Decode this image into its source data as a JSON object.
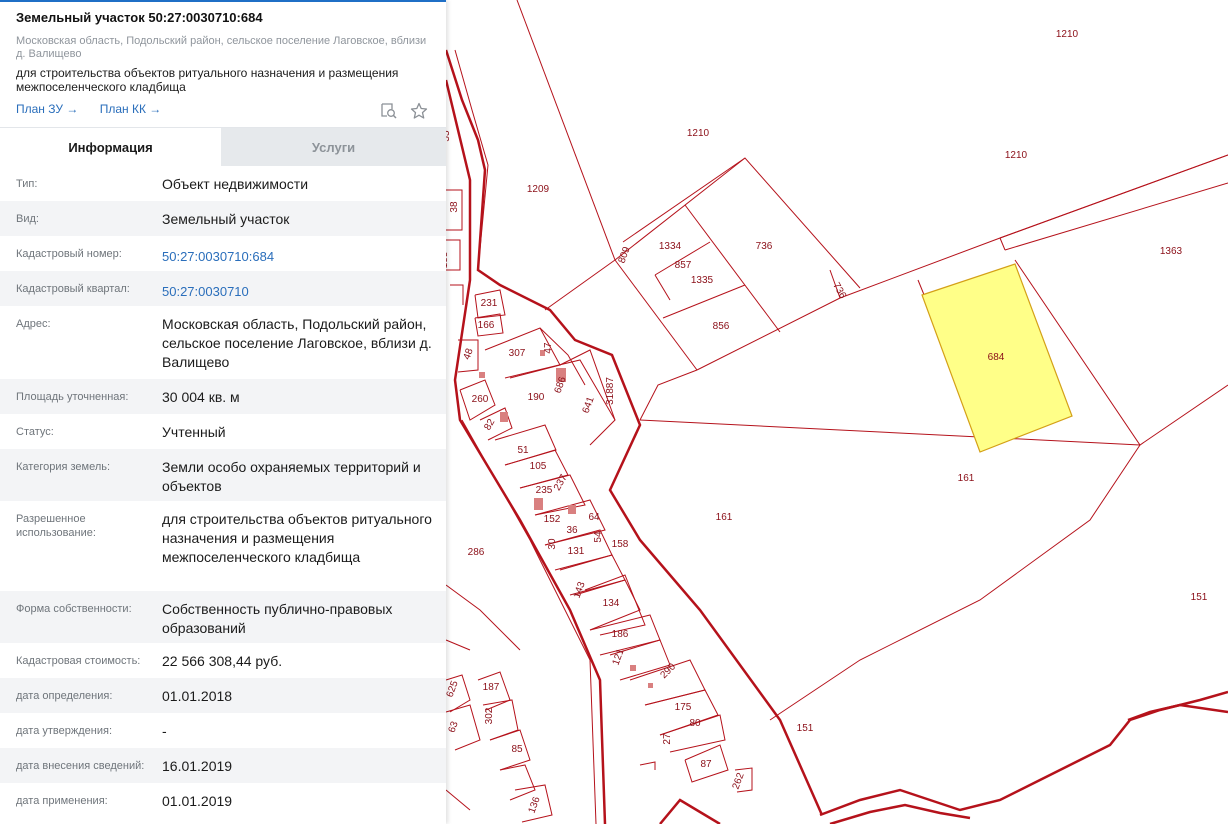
{
  "panel": {
    "title": "Земельный участок 50:27:0030710:684",
    "address": "Московская область, Подольский район, сельское поселение Лаговское, вблизи д. Валищево",
    "purpose": "для строительства объектов ритуального назначения и размещения межпоселенческого кладбища",
    "links": {
      "plan_zu": "План ЗУ →",
      "plan_kk": "План КК →"
    },
    "icons": [
      "search-map-icon",
      "star-icon"
    ],
    "tabs": [
      {
        "label": "Информация",
        "active": true
      },
      {
        "label": "Услуги",
        "active": false
      }
    ],
    "fields": [
      {
        "label": "Тип:",
        "value": "Объект недвижимости"
      },
      {
        "label": "Вид:",
        "value": "Земельный участок"
      },
      {
        "label": "Кадастровый номер:",
        "value": "50:27:0030710:684",
        "link": true
      },
      {
        "label": "Кадастровый квартал:",
        "value": "50:27:0030710",
        "link": true
      },
      {
        "label": "Адрес:",
        "value": "Московская область, Подольский район, сельское поселение Лаговское, вблизи д. Валищево"
      },
      {
        "label": "Площадь уточненная:",
        "value": "30 004 кв. м"
      },
      {
        "label": "Статус:",
        "value": "Учтенный"
      },
      {
        "label": "Категория земель:",
        "value": "Земли особо охраняемых территорий и объектов"
      },
      {
        "label": "Разрешенное использование:",
        "value": "для строительства объектов ритуального назначения и размещения межпоселенческого кладбища"
      },
      {
        "label": "Форма собственности:",
        "value": "Собственность публично-правовых образований"
      },
      {
        "label": "Кадастровая стоимость:",
        "value": "22 566 308,44 руб."
      },
      {
        "label": "дата определения:",
        "value": "01.01.2018"
      },
      {
        "label": "дата утверждения:",
        "value": "-"
      },
      {
        "label": "дата внесения сведений:",
        "value": "16.01.2019"
      },
      {
        "label": "дата применения:",
        "value": "01.01.2019"
      }
    ]
  },
  "map": {
    "colors": {
      "border": "#b5121b",
      "highlight_fill": "#ffff88",
      "highlight_stroke": "#d4a017",
      "label": "#8b0f18"
    },
    "highlighted_parcel": "684",
    "labels": [
      "1210",
      "1210",
      "1210",
      "1209",
      "1363",
      "809",
      "1334",
      "857",
      "1335",
      "736",
      "736",
      "856",
      "684",
      "161",
      "161",
      "151",
      "151",
      "286",
      "231",
      "166",
      "307",
      "47",
      "48",
      "190",
      "641",
      "31887",
      "260",
      "82",
      "51",
      "105",
      "237",
      "235",
      "152",
      "36",
      "64",
      "30",
      "131",
      "54",
      "158",
      "143",
      "134",
      "186",
      "121",
      "290",
      "175",
      "27",
      "80",
      "87",
      "262",
      "625",
      "187",
      "302",
      "63",
      "85",
      "136",
      "38",
      "55",
      "121",
      "133",
      "686"
    ]
  }
}
